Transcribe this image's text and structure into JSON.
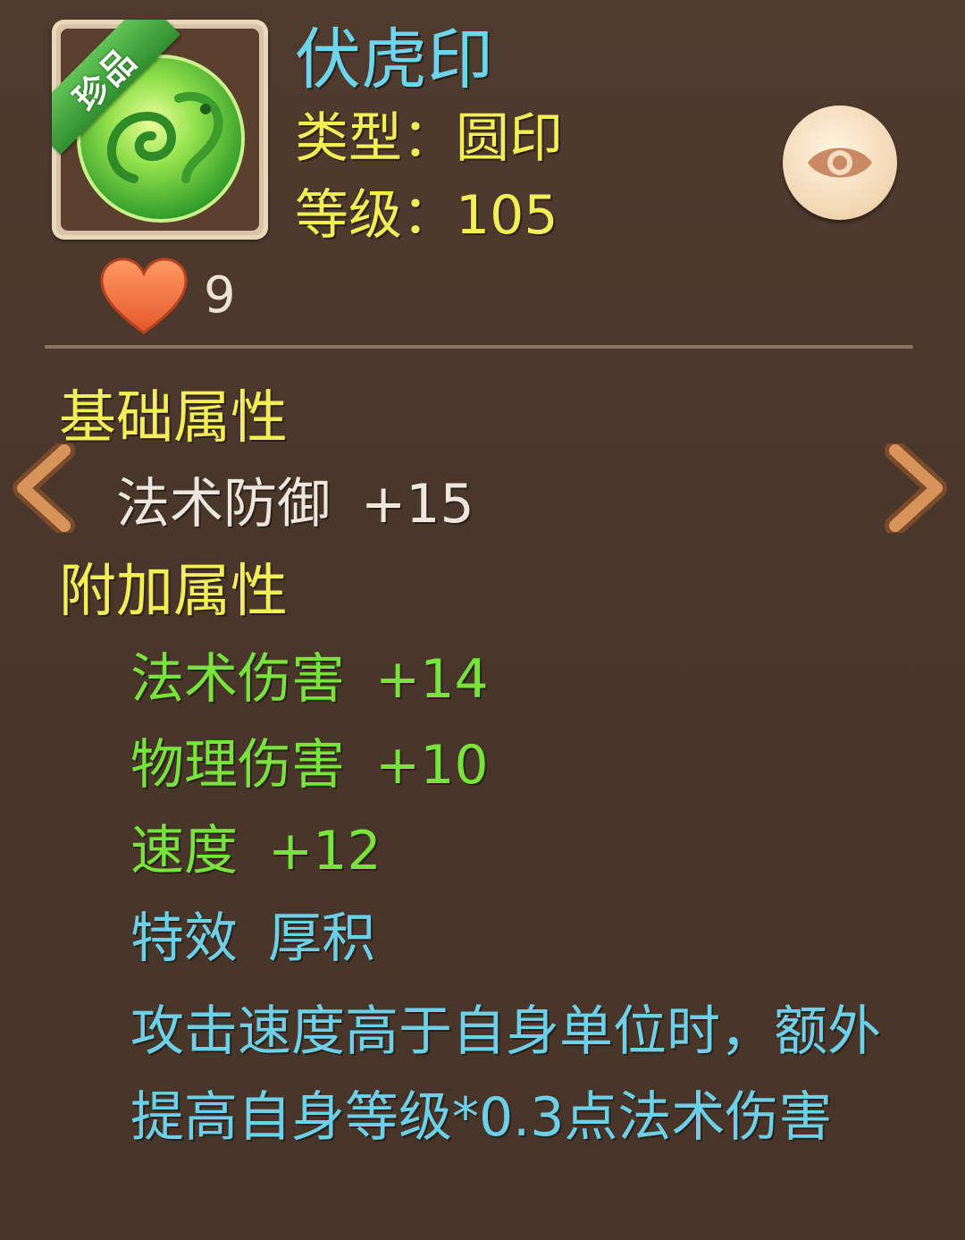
{
  "item": {
    "badge": "珍品",
    "name": "伏虎印",
    "type_label": "类型：",
    "type_value": "圆印",
    "level_label": "等级：",
    "level_value": "105",
    "favorites": "9"
  },
  "base_section": {
    "title": "基础属性",
    "attrs": [
      {
        "name": "法术防御",
        "value": "+15"
      }
    ]
  },
  "extra_section": {
    "title": "附加属性",
    "attrs": [
      {
        "name": "法术伤害",
        "value": "+14"
      },
      {
        "name": "物理伤害",
        "value": "+10"
      },
      {
        "name": "速度",
        "value": "+12"
      }
    ],
    "effect_label": "特效",
    "effect_name": "厚积",
    "effect_desc": "攻击速度高于自身单位时，额外提高自身等级*0.3点法术伤害"
  },
  "icons": {
    "view": "eye-icon",
    "favorite": "heart-icon",
    "prev": "chevron-left-icon",
    "next": "chevron-right-icon"
  },
  "colors": {
    "name": "#6cd5ee",
    "label_yellow": "#f2ee55",
    "extra_green": "#79e33d",
    "effect_cyan": "#6cd0e8",
    "badge_green": "#3fa83c"
  }
}
